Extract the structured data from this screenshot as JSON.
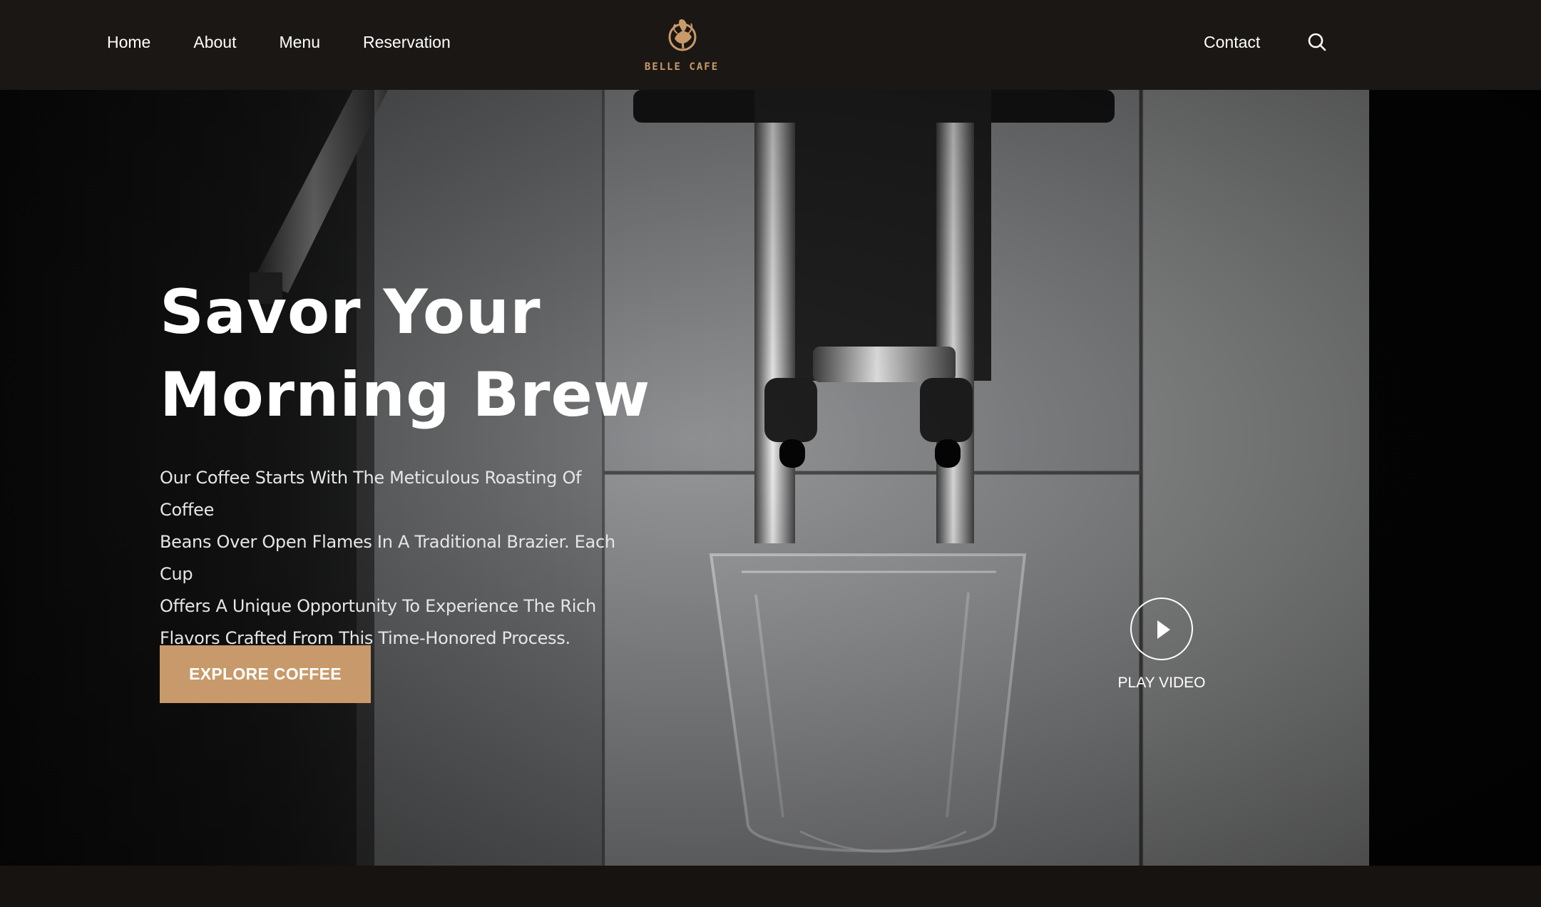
{
  "nav": {
    "left": [
      "Home",
      "About",
      "Menu",
      "Reservation"
    ],
    "contact": "Contact",
    "search_icon": "search-icon"
  },
  "logo": {
    "text": "BELLE CAFE"
  },
  "hero": {
    "title_line1": "Savor Your",
    "title_line2": "Morning Brew",
    "lead_lines": [
      "Our Coffee Starts With The Meticulous Roasting Of Coffee",
      "Beans Over Open Flames In A Traditional Brazier. Each Cup",
      "Offers A Unique Opportunity To Experience The Rich",
      "Flavors Crafted From This Time-Honored Process."
    ],
    "cta_label": "EXPLORE COFFEE",
    "play_label": "PLAY VIDEO"
  },
  "colors": {
    "topbar": "#1b1714",
    "accent": "#c89a6b",
    "text": "#ffffff"
  }
}
